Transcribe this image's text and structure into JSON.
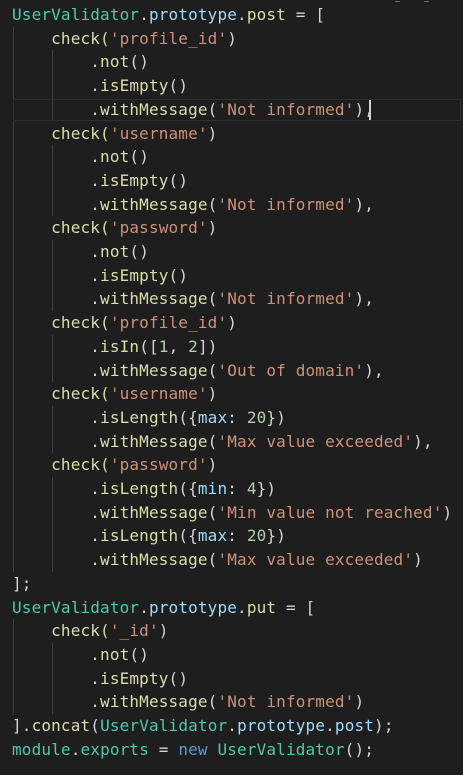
{
  "editor": {
    "theme_colors": {
      "background": "#1e1e1e",
      "text": "#d4d4d4",
      "class": "#4ec9b0",
      "property": "#9cdcfe",
      "function": "#dcdcaa",
      "string": "#ce9178",
      "number": "#b5cea8",
      "keyword": "#569cd6"
    },
    "lines": [
      [
        {
          "t": "UserValidator",
          "c": "cls"
        },
        {
          "t": ".",
          "c": "pun"
        },
        {
          "t": "prototype",
          "c": "prop"
        },
        {
          "t": ".",
          "c": "pun"
        },
        {
          "t": "post",
          "c": "fn"
        },
        {
          "t": " = [",
          "c": "pun"
        }
      ],
      [
        {
          "t": "    check(",
          "c": "fn"
        },
        {
          "t": "'profile_id'",
          "c": "str"
        },
        {
          "t": ")",
          "c": "pun"
        }
      ],
      [
        {
          "t": "        .",
          "c": "pun"
        },
        {
          "t": "not",
          "c": "fn"
        },
        {
          "t": "()",
          "c": "pun"
        }
      ],
      [
        {
          "t": "        .",
          "c": "pun"
        },
        {
          "t": "isEmpty",
          "c": "fn"
        },
        {
          "t": "()",
          "c": "pun"
        }
      ],
      [
        {
          "t": "        .",
          "c": "pun"
        },
        {
          "t": "withMessage",
          "c": "fn"
        },
        {
          "t": "(",
          "c": "pun"
        },
        {
          "t": "'Not informed'",
          "c": "str"
        },
        {
          "t": "),",
          "c": "pun"
        }
      ],
      [
        {
          "t": "    check(",
          "c": "fn"
        },
        {
          "t": "'username'",
          "c": "str"
        },
        {
          "t": ")",
          "c": "pun"
        }
      ],
      [
        {
          "t": "        .",
          "c": "pun"
        },
        {
          "t": "not",
          "c": "fn"
        },
        {
          "t": "()",
          "c": "pun"
        }
      ],
      [
        {
          "t": "        .",
          "c": "pun"
        },
        {
          "t": "isEmpty",
          "c": "fn"
        },
        {
          "t": "()",
          "c": "pun"
        }
      ],
      [
        {
          "t": "        .",
          "c": "pun"
        },
        {
          "t": "withMessage",
          "c": "fn"
        },
        {
          "t": "(",
          "c": "pun"
        },
        {
          "t": "'Not informed'",
          "c": "str"
        },
        {
          "t": "),",
          "c": "pun"
        }
      ],
      [
        {
          "t": "    check(",
          "c": "fn"
        },
        {
          "t": "'password'",
          "c": "str"
        },
        {
          "t": ")",
          "c": "pun"
        }
      ],
      [
        {
          "t": "        .",
          "c": "pun"
        },
        {
          "t": "not",
          "c": "fn"
        },
        {
          "t": "()",
          "c": "pun"
        }
      ],
      [
        {
          "t": "        .",
          "c": "pun"
        },
        {
          "t": "isEmpty",
          "c": "fn"
        },
        {
          "t": "()",
          "c": "pun"
        }
      ],
      [
        {
          "t": "        .",
          "c": "pun"
        },
        {
          "t": "withMessage",
          "c": "fn"
        },
        {
          "t": "(",
          "c": "pun"
        },
        {
          "t": "'Not informed'",
          "c": "str"
        },
        {
          "t": "),",
          "c": "pun"
        }
      ],
      [
        {
          "t": "    check(",
          "c": "fn"
        },
        {
          "t": "'profile_id'",
          "c": "str"
        },
        {
          "t": ")",
          "c": "pun"
        }
      ],
      [
        {
          "t": "        .",
          "c": "pun"
        },
        {
          "t": "isIn",
          "c": "fn"
        },
        {
          "t": "([",
          "c": "pun"
        },
        {
          "t": "1",
          "c": "num"
        },
        {
          "t": ", ",
          "c": "pun"
        },
        {
          "t": "2",
          "c": "num"
        },
        {
          "t": "])",
          "c": "pun"
        }
      ],
      [
        {
          "t": "        .",
          "c": "pun"
        },
        {
          "t": "withMessage",
          "c": "fn"
        },
        {
          "t": "(",
          "c": "pun"
        },
        {
          "t": "'Out of domain'",
          "c": "str"
        },
        {
          "t": "),",
          "c": "pun"
        }
      ],
      [
        {
          "t": "    check(",
          "c": "fn"
        },
        {
          "t": "'username'",
          "c": "str"
        },
        {
          "t": ")",
          "c": "pun"
        }
      ],
      [
        {
          "t": "        .",
          "c": "pun"
        },
        {
          "t": "isLength",
          "c": "fn"
        },
        {
          "t": "({",
          "c": "pun"
        },
        {
          "t": "max",
          "c": "prop"
        },
        {
          "t": ": ",
          "c": "pun"
        },
        {
          "t": "20",
          "c": "num"
        },
        {
          "t": "})",
          "c": "pun"
        }
      ],
      [
        {
          "t": "        .",
          "c": "pun"
        },
        {
          "t": "withMessage",
          "c": "fn"
        },
        {
          "t": "(",
          "c": "pun"
        },
        {
          "t": "'Max value exceeded'",
          "c": "str"
        },
        {
          "t": "),",
          "c": "pun"
        }
      ],
      [
        {
          "t": "    check(",
          "c": "fn"
        },
        {
          "t": "'password'",
          "c": "str"
        },
        {
          "t": ")",
          "c": "pun"
        }
      ],
      [
        {
          "t": "        .",
          "c": "pun"
        },
        {
          "t": "isLength",
          "c": "fn"
        },
        {
          "t": "({",
          "c": "pun"
        },
        {
          "t": "min",
          "c": "prop"
        },
        {
          "t": ": ",
          "c": "pun"
        },
        {
          "t": "4",
          "c": "num"
        },
        {
          "t": "})",
          "c": "pun"
        }
      ],
      [
        {
          "t": "        .",
          "c": "pun"
        },
        {
          "t": "withMessage",
          "c": "fn"
        },
        {
          "t": "(",
          "c": "pun"
        },
        {
          "t": "'Min value not reached'",
          "c": "str"
        },
        {
          "t": ")",
          "c": "pun"
        }
      ],
      [
        {
          "t": "        .",
          "c": "pun"
        },
        {
          "t": "isLength",
          "c": "fn"
        },
        {
          "t": "({",
          "c": "pun"
        },
        {
          "t": "max",
          "c": "prop"
        },
        {
          "t": ": ",
          "c": "pun"
        },
        {
          "t": "20",
          "c": "num"
        },
        {
          "t": "})",
          "c": "pun"
        }
      ],
      [
        {
          "t": "        .",
          "c": "pun"
        },
        {
          "t": "withMessage",
          "c": "fn"
        },
        {
          "t": "(",
          "c": "pun"
        },
        {
          "t": "'Max value exceeded'",
          "c": "str"
        },
        {
          "t": ")",
          "c": "pun"
        }
      ],
      [
        {
          "t": "];",
          "c": "pun"
        }
      ],
      [
        {
          "t": "UserValidator",
          "c": "cls"
        },
        {
          "t": ".",
          "c": "pun"
        },
        {
          "t": "prototype",
          "c": "prop"
        },
        {
          "t": ".",
          "c": "pun"
        },
        {
          "t": "put",
          "c": "fn"
        },
        {
          "t": " = [",
          "c": "pun"
        }
      ],
      [
        {
          "t": "    check(",
          "c": "fn"
        },
        {
          "t": "'_id'",
          "c": "str"
        },
        {
          "t": ")",
          "c": "pun"
        }
      ],
      [
        {
          "t": "        .",
          "c": "pun"
        },
        {
          "t": "not",
          "c": "fn"
        },
        {
          "t": "()",
          "c": "pun"
        }
      ],
      [
        {
          "t": "        .",
          "c": "pun"
        },
        {
          "t": "isEmpty",
          "c": "fn"
        },
        {
          "t": "()",
          "c": "pun"
        }
      ],
      [
        {
          "t": "        .",
          "c": "pun"
        },
        {
          "t": "withMessage",
          "c": "fn"
        },
        {
          "t": "(",
          "c": "pun"
        },
        {
          "t": "'Not informed'",
          "c": "str"
        },
        {
          "t": ")",
          "c": "pun"
        }
      ],
      [
        {
          "t": "].",
          "c": "pun"
        },
        {
          "t": "concat",
          "c": "fn"
        },
        {
          "t": "(",
          "c": "pun"
        },
        {
          "t": "UserValidator",
          "c": "cls"
        },
        {
          "t": ".",
          "c": "pun"
        },
        {
          "t": "prototype",
          "c": "prop"
        },
        {
          "t": ".",
          "c": "pun"
        },
        {
          "t": "post",
          "c": "prop"
        },
        {
          "t": ");",
          "c": "pun"
        }
      ],
      [
        {
          "t": "module",
          "c": "cls"
        },
        {
          "t": ".",
          "c": "pun"
        },
        {
          "t": "exports",
          "c": "cls"
        },
        {
          "t": " = ",
          "c": "pun"
        },
        {
          "t": "new ",
          "c": "kw"
        },
        {
          "t": "UserValidator",
          "c": "cls"
        },
        {
          "t": "();",
          "c": "pun"
        }
      ]
    ]
  }
}
